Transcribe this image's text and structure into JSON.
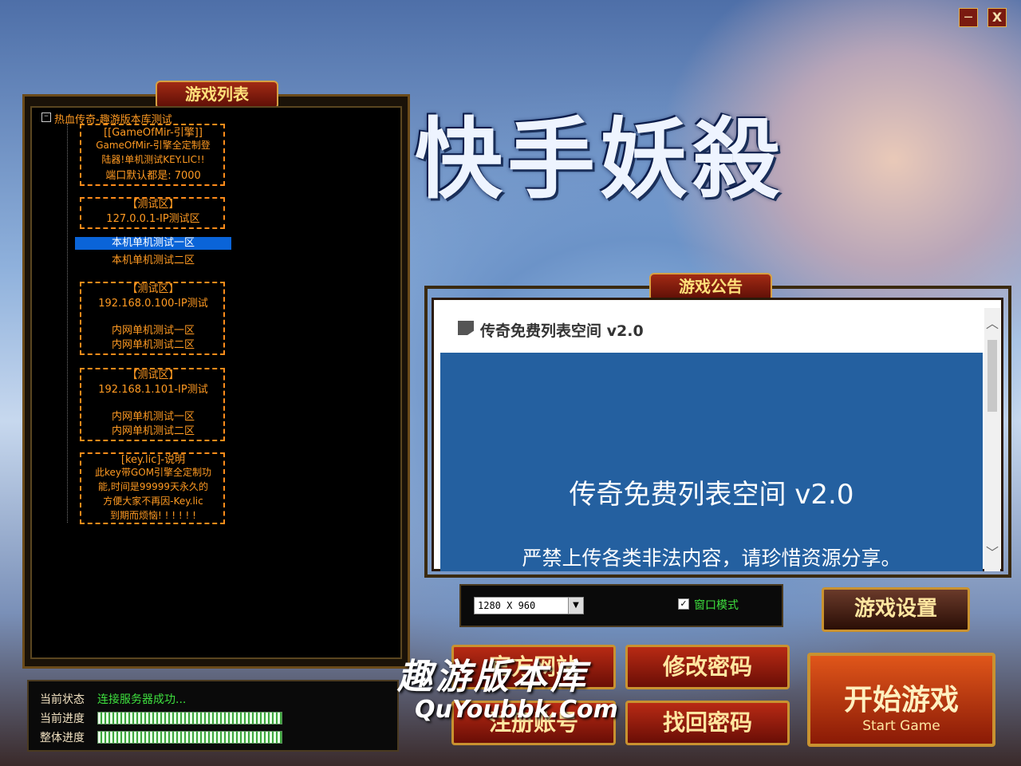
{
  "window": {
    "minimize_glyph": "─",
    "close_glyph": "X"
  },
  "game_list": {
    "title": "游戏列表",
    "root": "热血传奇-趣游版本库测试",
    "info_box": [
      "[[GameOfMir-引擎]]",
      "GameOfMir-引擎全定制登",
      "陆器!单机测试KEY.LIC!!",
      "端口默认都是: 7000"
    ],
    "group1": {
      "header": "【测试区】",
      "ip": "127.0.0.1-IP测试区",
      "items": [
        "本机单机测试一区",
        "本机单机测试二区"
      ]
    },
    "group2": {
      "header": "【测试区】",
      "ip": "192.168.0.100-IP测试",
      "items": [
        "内网单机测试一区",
        "内网单机测试二区"
      ]
    },
    "group3": {
      "header": "【测试区】",
      "ip": "192.168.1.101-IP测试",
      "items": [
        "内网单机测试一区",
        "内网单机测试二区"
      ]
    },
    "key_box": [
      "[key.lic]-说明",
      "此key带GOM引擎全定制功",
      "能,时间是99999天永久的",
      "方便大家不再因-Key.lic",
      "到期而烦恼! ! ! ! ! !"
    ]
  },
  "logo_text": "快手妖殺",
  "notice": {
    "title": "游戏公告",
    "header_icon": "bookmark-icon",
    "header": "传奇免费列表空间 v2.0",
    "banner_title": "传奇免费列表空间 v2.0",
    "banner_sub": "严禁上传各类非法内容，请珍惜资源分享。",
    "banner_color": "#2460a0"
  },
  "settings": {
    "resolution": "1280 X 960",
    "window_mode_label": "窗口模式",
    "window_mode_checked": true,
    "settings_button": "游戏设置"
  },
  "buttons": {
    "website": "官方网站",
    "change_password": "修改密码",
    "register": "注册账号",
    "recover_password": "找回密码",
    "start": "开始游戏",
    "start_en": "Start Game"
  },
  "status": {
    "state_label": "当前状态",
    "state_value": "连接服务器成功...",
    "current_label": "当前进度",
    "total_label": "整体进度",
    "current_progress": 1.0,
    "total_progress": 1.0
  },
  "watermark": {
    "cn": "趣游版本库",
    "en": "QuYoubbk.Com"
  }
}
